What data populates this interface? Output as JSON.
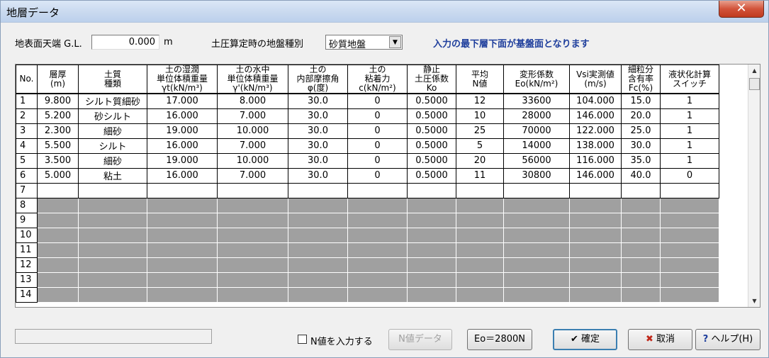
{
  "window": {
    "title": "地層データ",
    "close_glyph": "✕"
  },
  "top": {
    "gl_label": "地表面天端 G.L.",
    "gl_value": "0.000",
    "gl_unit": "m",
    "ground_label": "土圧算定時の地盤種別",
    "ground_value": "砂質地盤",
    "notice": "入力の最下層下面が基盤面となります"
  },
  "grid": {
    "headers": [
      [
        "No."
      ],
      [
        "層厚",
        "(m)"
      ],
      [
        "土質",
        "種類"
      ],
      [
        "土の湿潤",
        "単位体積重量",
        "γt(kN/m³)"
      ],
      [
        "土の水中",
        "単位体積重量",
        "γ'(kN/m³)"
      ],
      [
        "土の",
        "内部摩擦角",
        "φ(度)"
      ],
      [
        "土の",
        "粘着力",
        "c(kN/m²)"
      ],
      [
        "静止",
        "土圧係数",
        "Ko"
      ],
      [
        "平均",
        "N値"
      ],
      [
        "変形係数",
        "Eo(kN/m²)"
      ],
      [
        "Vsi実測値",
        "(m/s)"
      ],
      [
        "細粒分",
        "含有率",
        "Fc(%)"
      ],
      [
        "液状化計算",
        "スイッチ"
      ]
    ],
    "rows": [
      [
        "1",
        "9.800",
        "シルト質細砂",
        "17.000",
        "8.000",
        "30.0",
        "0",
        "0.5000",
        "12",
        "33600",
        "104.000",
        "15.0",
        "1"
      ],
      [
        "2",
        "5.200",
        "砂シルト",
        "16.000",
        "7.000",
        "30.0",
        "0",
        "0.5000",
        "10",
        "28000",
        "146.000",
        "20.0",
        "1"
      ],
      [
        "3",
        "2.300",
        "細砂",
        "19.000",
        "10.000",
        "30.0",
        "0",
        "0.5000",
        "25",
        "70000",
        "122.000",
        "25.0",
        "1"
      ],
      [
        "4",
        "5.500",
        "シルト",
        "16.000",
        "7.000",
        "30.0",
        "0",
        "0.5000",
        "5",
        "14000",
        "138.000",
        "30.0",
        "1"
      ],
      [
        "5",
        "3.500",
        "細砂",
        "19.000",
        "10.000",
        "30.0",
        "0",
        "0.5000",
        "20",
        "56000",
        "116.000",
        "35.0",
        "1"
      ],
      [
        "6",
        "5.000",
        "粘土",
        "16.000",
        "7.000",
        "30.0",
        "0",
        "0.5000",
        "11",
        "30800",
        "146.000",
        "40.0",
        "0"
      ]
    ],
    "blank_rows": [
      "7"
    ],
    "empty_rows": [
      "8",
      "9",
      "10",
      "11",
      "12",
      "13",
      "14"
    ]
  },
  "bottom": {
    "status_text": "",
    "n_checkbox_label": "N値を入力する",
    "n_data_button": "N値データ",
    "eo_button": "Eo＝2800N",
    "ok_button": "確定",
    "cancel_button": "取消",
    "help_button": "ヘルプ(H)"
  },
  "colors": {
    "title_bg": "#c9d9ef",
    "close_bg": "#d2533a",
    "notice": "#1e3e9c",
    "empty_cell": "#a0a0a0",
    "default_button_border": "#3c7fb1"
  }
}
